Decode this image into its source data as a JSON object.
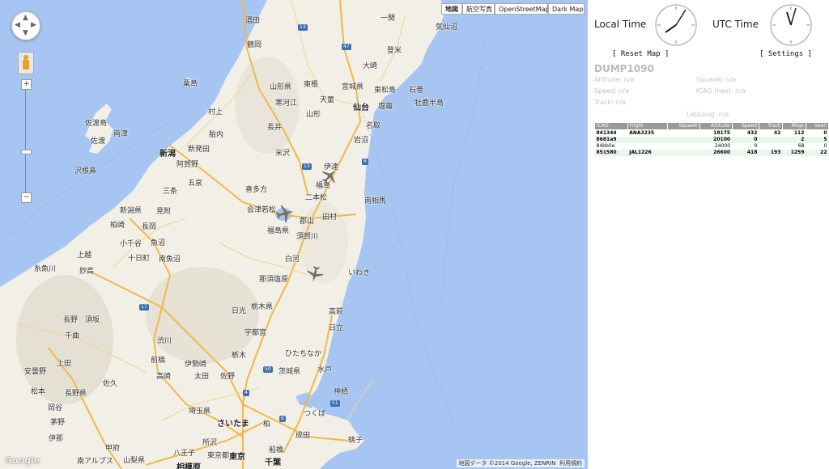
{
  "map": {
    "types": [
      "地図",
      "航空写真",
      "OpenStreetMap",
      "Dark Map"
    ],
    "active_type": "地図",
    "footer": "地図データ ©2014 Google, ZENRIN",
    "terms": "利用規約",
    "logo": "Google",
    "zoom_in": "+",
    "zoom_out": "−",
    "zoom_minus_mid": "−",
    "pan_icons": [
      "chevron-up-icon",
      "chevron-left-icon",
      "chevron-right-icon",
      "chevron-down-icon"
    ],
    "labels": {
      "sakata": "酒田",
      "ichinoseki": "一関",
      "kesennuma": "気仙沼",
      "tsuruoka": "鶴岡",
      "tome": "登米",
      "osaki": "大崎",
      "yamagata_pref": "山形県",
      "higashine": "東根",
      "miyagi_pref": "宮城県",
      "awashima": "粟島",
      "murakami": "村上",
      "sagae": "寒河江",
      "tendo": "天童",
      "higashimatsushima": "東松島",
      "ishinomaki": "石巻",
      "oshika": "牡鹿半島",
      "yamagata": "山形",
      "sendai": "仙台",
      "shiogama": "塩竈",
      "sadogashima": "佐渡島",
      "ryotsu": "両津",
      "sado": "佐渡",
      "tainai": "胎内",
      "nagai": "長井",
      "natori": "名取",
      "iwanuma": "岩沼",
      "niigata": "新潟",
      "shibata": "新発田",
      "yonezawa": "米沢",
      "sawane": "沢根鼻",
      "agano": "阿賀野",
      "gosen": "五泉",
      "date": "伊達",
      "sanjo": "三条",
      "kitakata": "喜多方",
      "fukushima": "福島",
      "nihonmatsu": "二本松",
      "minamisoma": "南相馬",
      "niigata_pref": "新潟県",
      "mitsuke": "見附",
      "aizuwakamatsu": "会津若松",
      "tamura": "田村",
      "kashiwazaki": "柏崎",
      "nagaoka": "長岡",
      "koriyama": "郡山",
      "fukushima_pref": "福島県",
      "ojiya": "小千谷",
      "uonuma": "魚沼",
      "sukagawa": "須賀川",
      "tokamachi": "十日町",
      "minamiuonuma": "南魚沼",
      "shirakawa": "白河",
      "joetsu": "上越",
      "myoko": "妙高",
      "iwaki": "いわき",
      "itoigawa": "糸魚川",
      "nasushiobara": "那須塩原",
      "nikko": "日光",
      "tochigi_pref": "栃木県",
      "nagano": "長野",
      "suzaka": "須坂",
      "takahagi": "高萩",
      "chikuma": "千曲",
      "shibukawa": "渋川",
      "utsunomiya": "宇都宮",
      "hitachi": "日立",
      "ueda": "上田",
      "maebashi": "前橋",
      "isesaki": "伊勢崎",
      "tochigi": "栃木",
      "hitachinaka": "ひたちなか",
      "azumino": "安曇野",
      "saku": "佐久",
      "takasaki": "高崎",
      "ota": "太田",
      "sano": "佐野",
      "ibaraki_pref": "茨城県",
      "mito": "水戸",
      "matsumoto": "松本",
      "nagano_pref": "長野県",
      "kamisu": "神栖",
      "okaya": "岡谷",
      "saitama_pref": "埼玉県",
      "tsukuba": "つくば",
      "chino": "茅野",
      "saitama": "さいたま",
      "kashiwa": "柏",
      "ina": "伊那",
      "narita": "成田",
      "choshi": "銚子",
      "kofu": "甲府",
      "tokorozawa": "所沢",
      "funabashi": "船橋",
      "hachioji": "八王子",
      "tokyo": "東京",
      "southalps": "南アルプス",
      "yamanashi": "山梨県",
      "chiba": "千葉",
      "sagamihara": "相模原",
      "tokyo_to": "東京都"
    }
  },
  "sidebar": {
    "local_time_label": "Local Time",
    "utc_time_label": "UTC Time",
    "reset_map": "[ Reset Map ]",
    "settings": "[ Settings ]",
    "title": "DUMP1090",
    "altitude": "Altitude: n/a",
    "squawk": "Squawk: n/a",
    "speed": "Speed: n/a",
    "icao_hex": "ICAO (hex): n/a",
    "track": "Track: n/a",
    "latlong": "Lat/Long: n/a"
  },
  "aircraft_table": {
    "headers": [
      "ICAO",
      "Flight",
      "Squawk",
      "Altitude",
      "Speed",
      "Track",
      "Msgs",
      "Seen"
    ],
    "rows": [
      {
        "icao": "841344",
        "flight": "ANA3235",
        "squawk": "",
        "altitude": "18175",
        "speed": "432",
        "track": "42",
        "msgs": "112",
        "seen": "0"
      },
      {
        "icao": "8681a9",
        "flight": "",
        "squawk": "",
        "altitude": "20100",
        "speed": "0",
        "track": "",
        "msgs": "2",
        "seen": "5"
      },
      {
        "icao": "84bb0e",
        "flight": "",
        "squawk": "",
        "altitude": "24000",
        "speed": "0",
        "track": "",
        "msgs": "68",
        "seen": "0"
      },
      {
        "icao": "851580",
        "flight": "JAL1226",
        "squawk": "",
        "altitude": "26600",
        "speed": "418",
        "track": "193",
        "msgs": "1259",
        "seen": "22"
      }
    ]
  },
  "colors": {
    "sea": "#a7c5f2",
    "land": "#f2efe6",
    "road": "#f6c56a",
    "header_gray": "#999999"
  }
}
